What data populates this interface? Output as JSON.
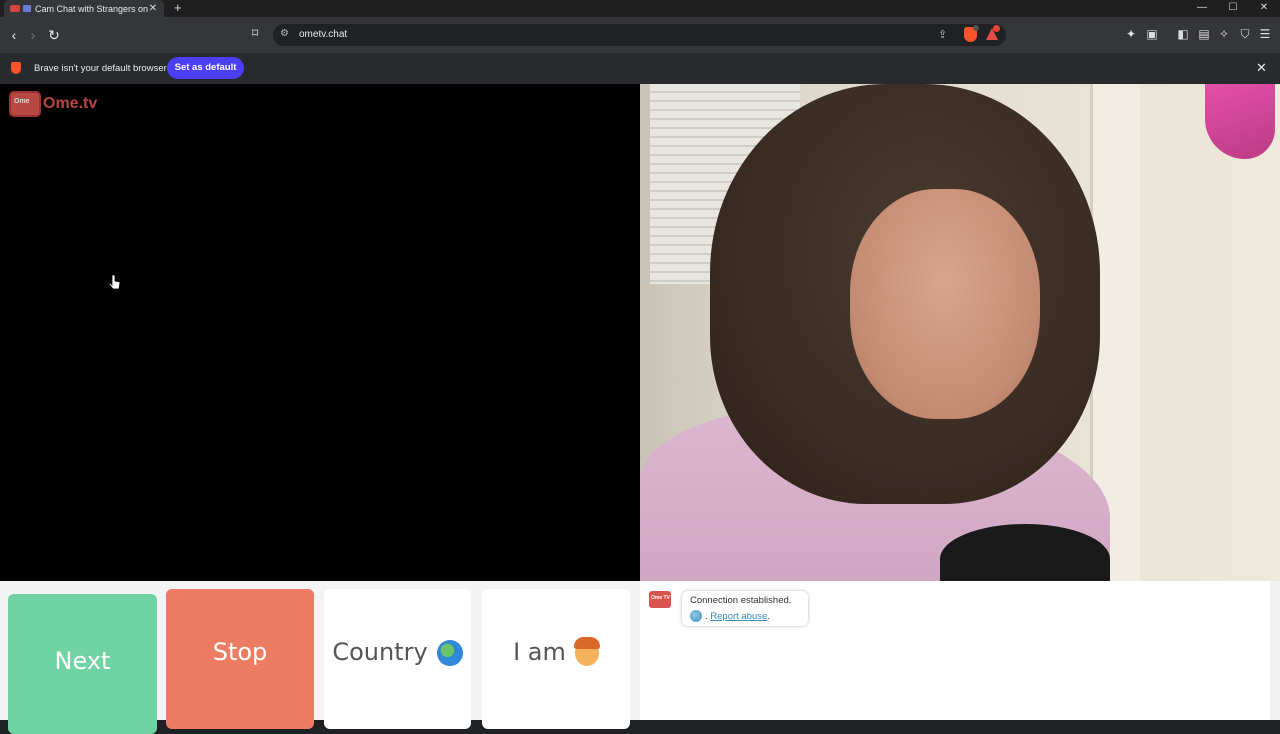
{
  "browser": {
    "tab_title": "Cam Chat with Strangers on O",
    "tab_close": "✕",
    "new_tab": "+",
    "url": "ometv.chat",
    "window": {
      "minimize": "—",
      "maximize": "☐",
      "close": "✕"
    },
    "icons": [
      "back-icon",
      "forward-icon",
      "reload-icon",
      "bookmark-icon",
      "site-settings-icon",
      "share-icon",
      "brave-shields-icon",
      "brave-rewards-icon",
      "extensions-icon",
      "sidebar-icon",
      "wallet-icon",
      "leo-icon",
      "vpn-icon",
      "menu-icon"
    ]
  },
  "infobar": {
    "message": "Brave isn't your default browser",
    "button": "Set as default",
    "close": "✕"
  },
  "logo": {
    "tv_text": "Ome",
    "brand": "Ome.tv"
  },
  "controls": {
    "next": "Next",
    "stop": "Stop",
    "country": "Country",
    "iam": "I am"
  },
  "chat": {
    "tv_text": "Ome TV",
    "message": "Connection established.",
    "report_prefix": ". ",
    "report_link": "Report abuse",
    "report_suffix": "."
  },
  "colors": {
    "next": "#6fd3a4",
    "stop": "#ed7c63",
    "brave_purple": "#4c3ef5",
    "logo_red": "#d9534f"
  }
}
